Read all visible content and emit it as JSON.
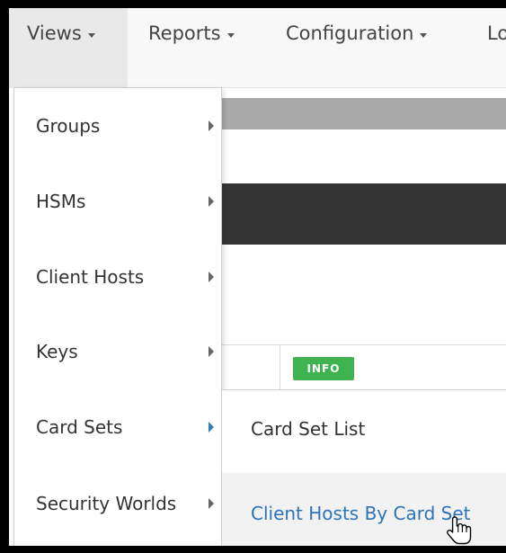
{
  "navbar": {
    "items": [
      {
        "label": "Views"
      },
      {
        "label": "Reports"
      },
      {
        "label": "Configuration"
      },
      {
        "label": "Lo"
      }
    ]
  },
  "page": {
    "info_badge": "INFO"
  },
  "views_menu": {
    "items": [
      {
        "label": "Groups"
      },
      {
        "label": "HSMs"
      },
      {
        "label": "Client Hosts"
      },
      {
        "label": "Keys"
      },
      {
        "label": "Card Sets"
      },
      {
        "label": "Security Worlds"
      }
    ]
  },
  "card_sets_submenu": {
    "items": [
      {
        "label": "Card Set List"
      },
      {
        "label": "Client Hosts By Card Set"
      }
    ]
  },
  "colors": {
    "link_hover": "#2d73b9",
    "info_badge": "#3fb34f",
    "dark_bar": "#353535",
    "gray_bar": "#a9a9a9"
  },
  "icons": {
    "cursor": "hand-pointer-icon"
  }
}
